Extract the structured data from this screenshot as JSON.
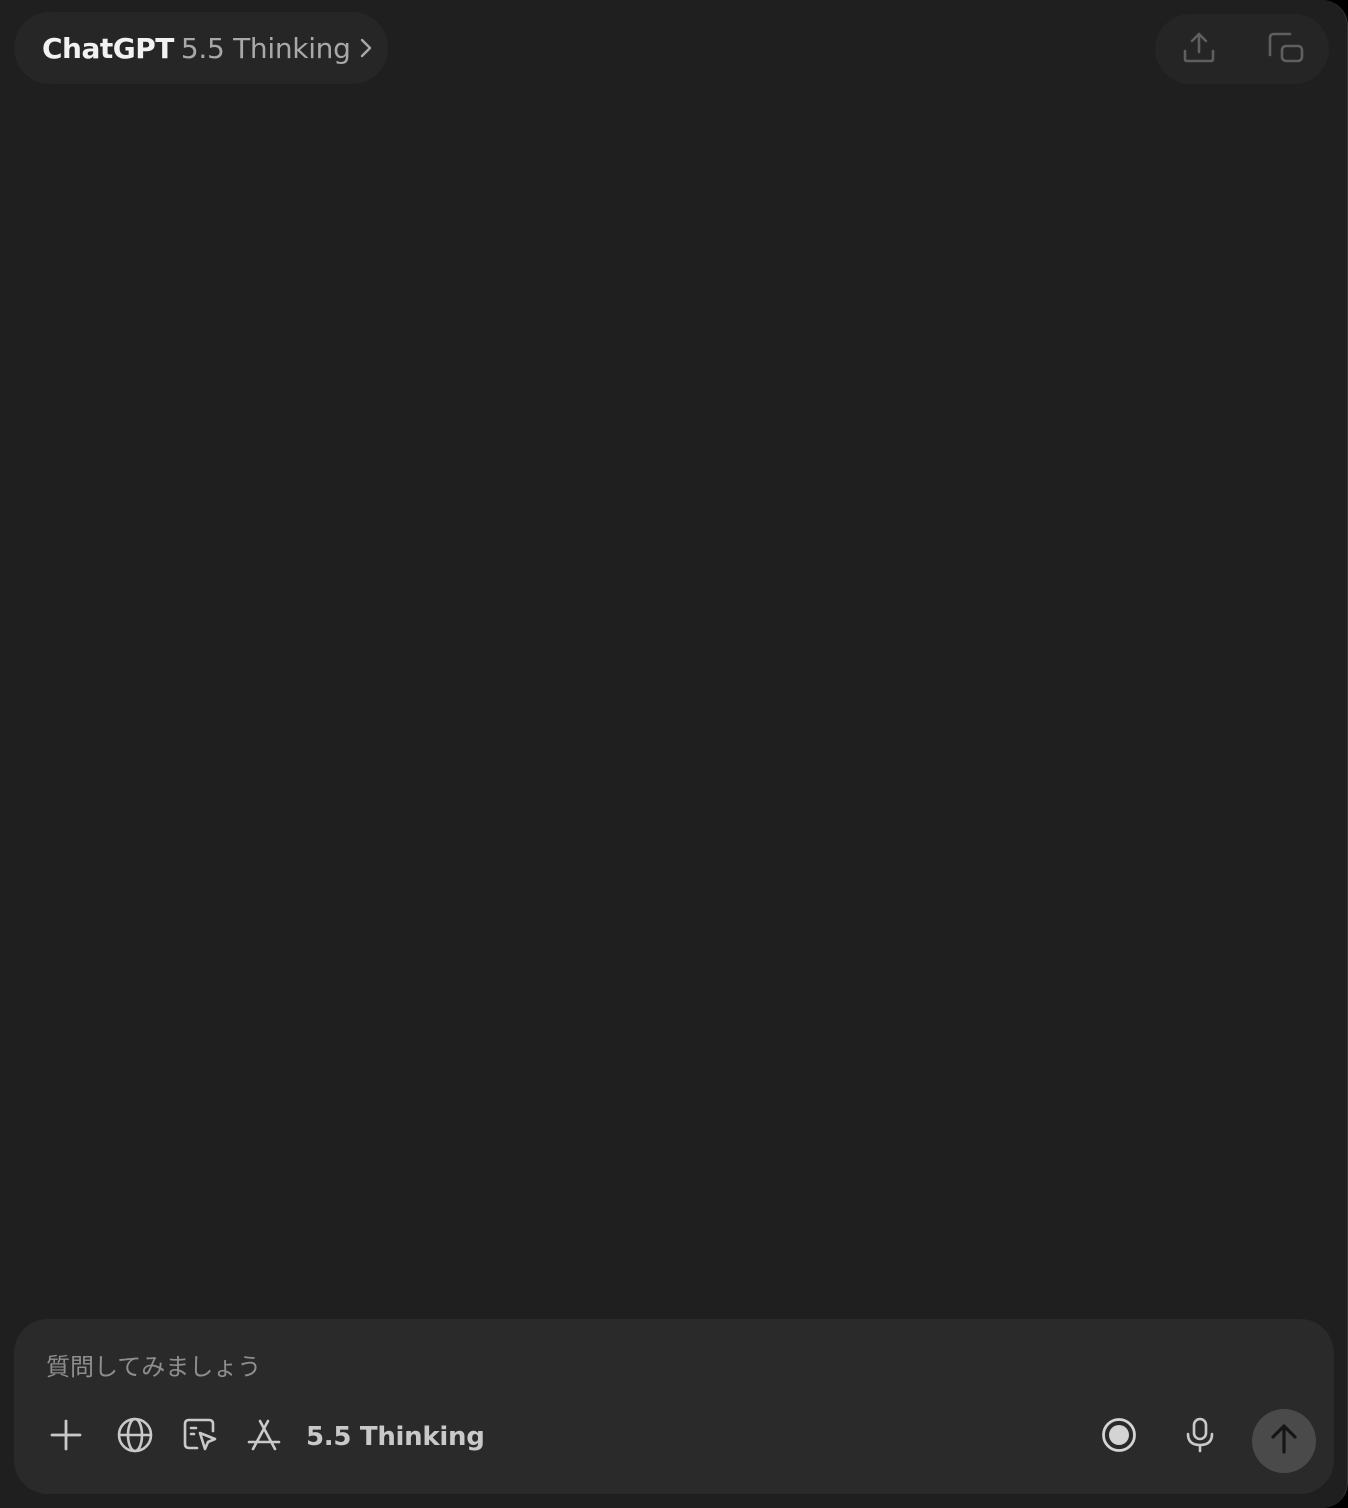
{
  "header": {
    "brand": "ChatGPT",
    "model": "5.5 Thinking",
    "share_icon": "share-upload-icon",
    "new_window_icon": "new-window-icon"
  },
  "composer": {
    "placeholder": "質問してみましょう",
    "value": "",
    "model_label": "5.5 Thinking",
    "tools": [
      "plus-icon",
      "globe-icon",
      "select-cursor-icon",
      "app-store-icon"
    ],
    "right_icons": [
      "record-icon",
      "microphone-icon",
      "arrow-up-icon"
    ]
  },
  "colors": {
    "background": "#1f1f1f",
    "composer": "#2a2a2a",
    "send_button": "#4a4a4a"
  }
}
